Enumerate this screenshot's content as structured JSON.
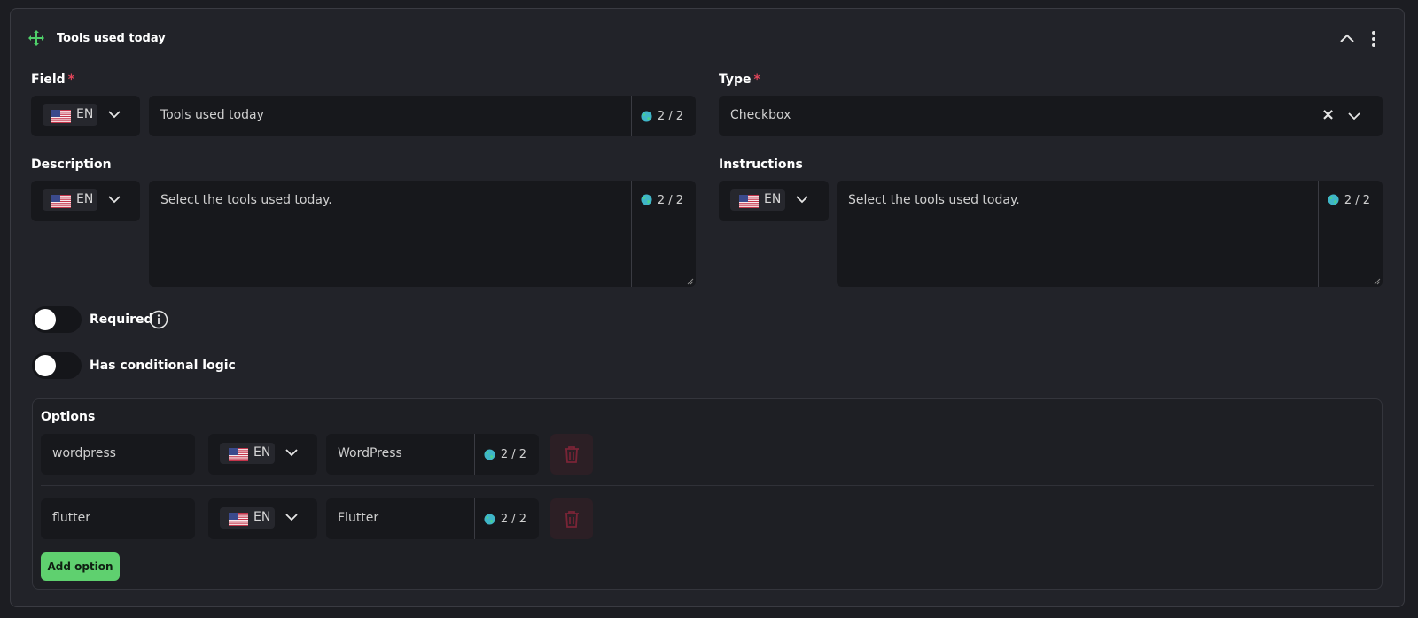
{
  "header": {
    "title": "Tools used today"
  },
  "field": {
    "label": "Field",
    "required_mark": "*",
    "lang": "EN",
    "value": "Tools used today",
    "counter": "2 / 2"
  },
  "type": {
    "label": "Type",
    "required_mark": "*",
    "value": "Checkbox",
    "clear": "×"
  },
  "description": {
    "label": "Description",
    "lang": "EN",
    "value": "Select the tools used today.",
    "counter": "2 / 2"
  },
  "instructions": {
    "label": "Instructions",
    "lang": "EN",
    "value": "Select the tools used today.",
    "counter": "2 / 2"
  },
  "toggles": {
    "required_label": "Required",
    "conditional_label": "Has conditional logic"
  },
  "options": {
    "label": "Options",
    "items": [
      {
        "key": "wordpress",
        "lang": "EN",
        "value": "WordPress",
        "counter": "2 / 2"
      },
      {
        "key": "flutter",
        "lang": "EN",
        "value": "Flutter",
        "counter": "2 / 2"
      }
    ],
    "add_label": "Add option"
  },
  "colors": {
    "accent_green": "#5fd06f",
    "danger_red": "#e0455a",
    "background": "#222329"
  }
}
